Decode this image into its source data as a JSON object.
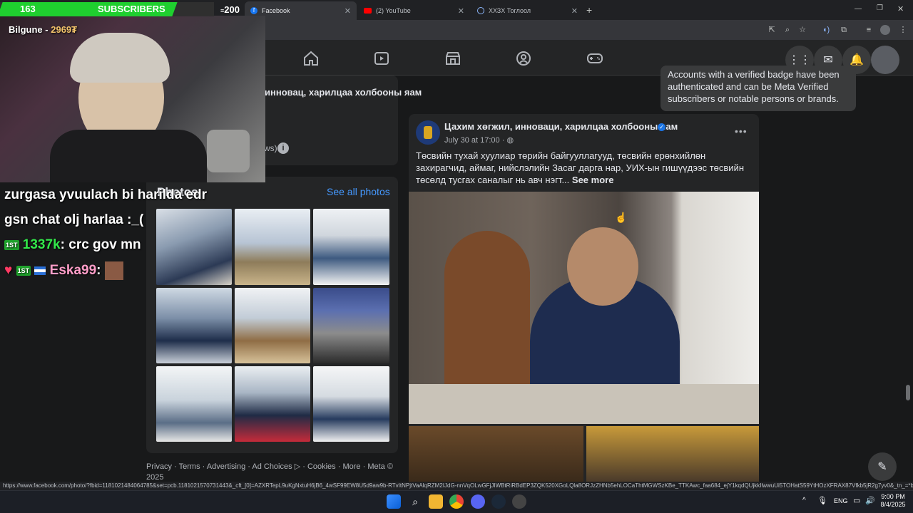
{
  "overlay": {
    "subs_count": "163",
    "subs_label": "SUBSCRIBERS",
    "subs_goal": "200",
    "subs_progress": 0.815,
    "streamer_name": "Bilgune",
    "streamer_points": "2969₮",
    "chat": [
      {
        "text": "zurgasa yvuulach bi harilda edr"
      },
      {
        "text": "gsn chat olj harlaa :_("
      },
      {
        "badge": "1ST",
        "user": "1337k",
        "msg": "crc gov mn"
      },
      {
        "badge": "1ST",
        "user": "Eska99",
        "msg": ""
      }
    ]
  },
  "browser": {
    "tabs": [
      {
        "label": "Facebook",
        "active": true,
        "icon": "facebook-icon"
      },
      {
        "label": "(2) YouTube",
        "active": false,
        "icon": "youtube-icon"
      },
      {
        "label": "ХХЗХ Тоглоол",
        "active": false,
        "icon": "globe-icon"
      }
    ],
    "new_tab": "+"
  },
  "facebook": {
    "tooltip": "Accounts with a verified badge have been authenticated and can be Meta Verified subscribers or notable persons or brands.",
    "page_name_partial": "инновац, харилцаа холбооны яам",
    "side_snippet": "ws)",
    "photos_title": "Photos",
    "see_all_photos": "See all photos",
    "footer_links": [
      "Privacy",
      "Terms",
      "Advertising",
      "Ad Choices",
      "Cookies",
      "More",
      "Meta © 2025"
    ],
    "post": {
      "author": "Цахим хөгжил, инноваци, харилцаа холбооны яам",
      "date": "July 30 at 17:00",
      "text": "Төсвийн тухай хуулиар төрийн байгууллагууд, төсвийн ерөнхийлөн захирагчид, аймаг, нийслэлийн Засаг дарга нар, УИХ-ын гишүүдээс төсвийн төсөлд тусгах саналыг нь авч нэгт...",
      "see_more": "See more"
    }
  },
  "status_url": "https://www.facebook.com/photo/?fbid=1181021484064785&set=pcb.1181021570731443&_cft_[0]=AZXRTepL9uKgNxtuH6jB6_4wSF99EW8U5d9aw9b-RTvItNPjtVaAlqRZM2IJdG-nnVqOLwGFjJIWBtRiRBdEP3ZQK520XGoLQla8ORJzZHNb5ehLOCaThtMGWSzKBe_TTKAwc_faa684_ejY1kqdQUjkkIlwwuUi5TOHatS59YtHOzXFRAX87Vfkb5jR2g7yv0&_tn_=*b...",
  "taskbar": {
    "lang": "ENG",
    "time": "9:00 PM",
    "date": "8/4/2025"
  }
}
